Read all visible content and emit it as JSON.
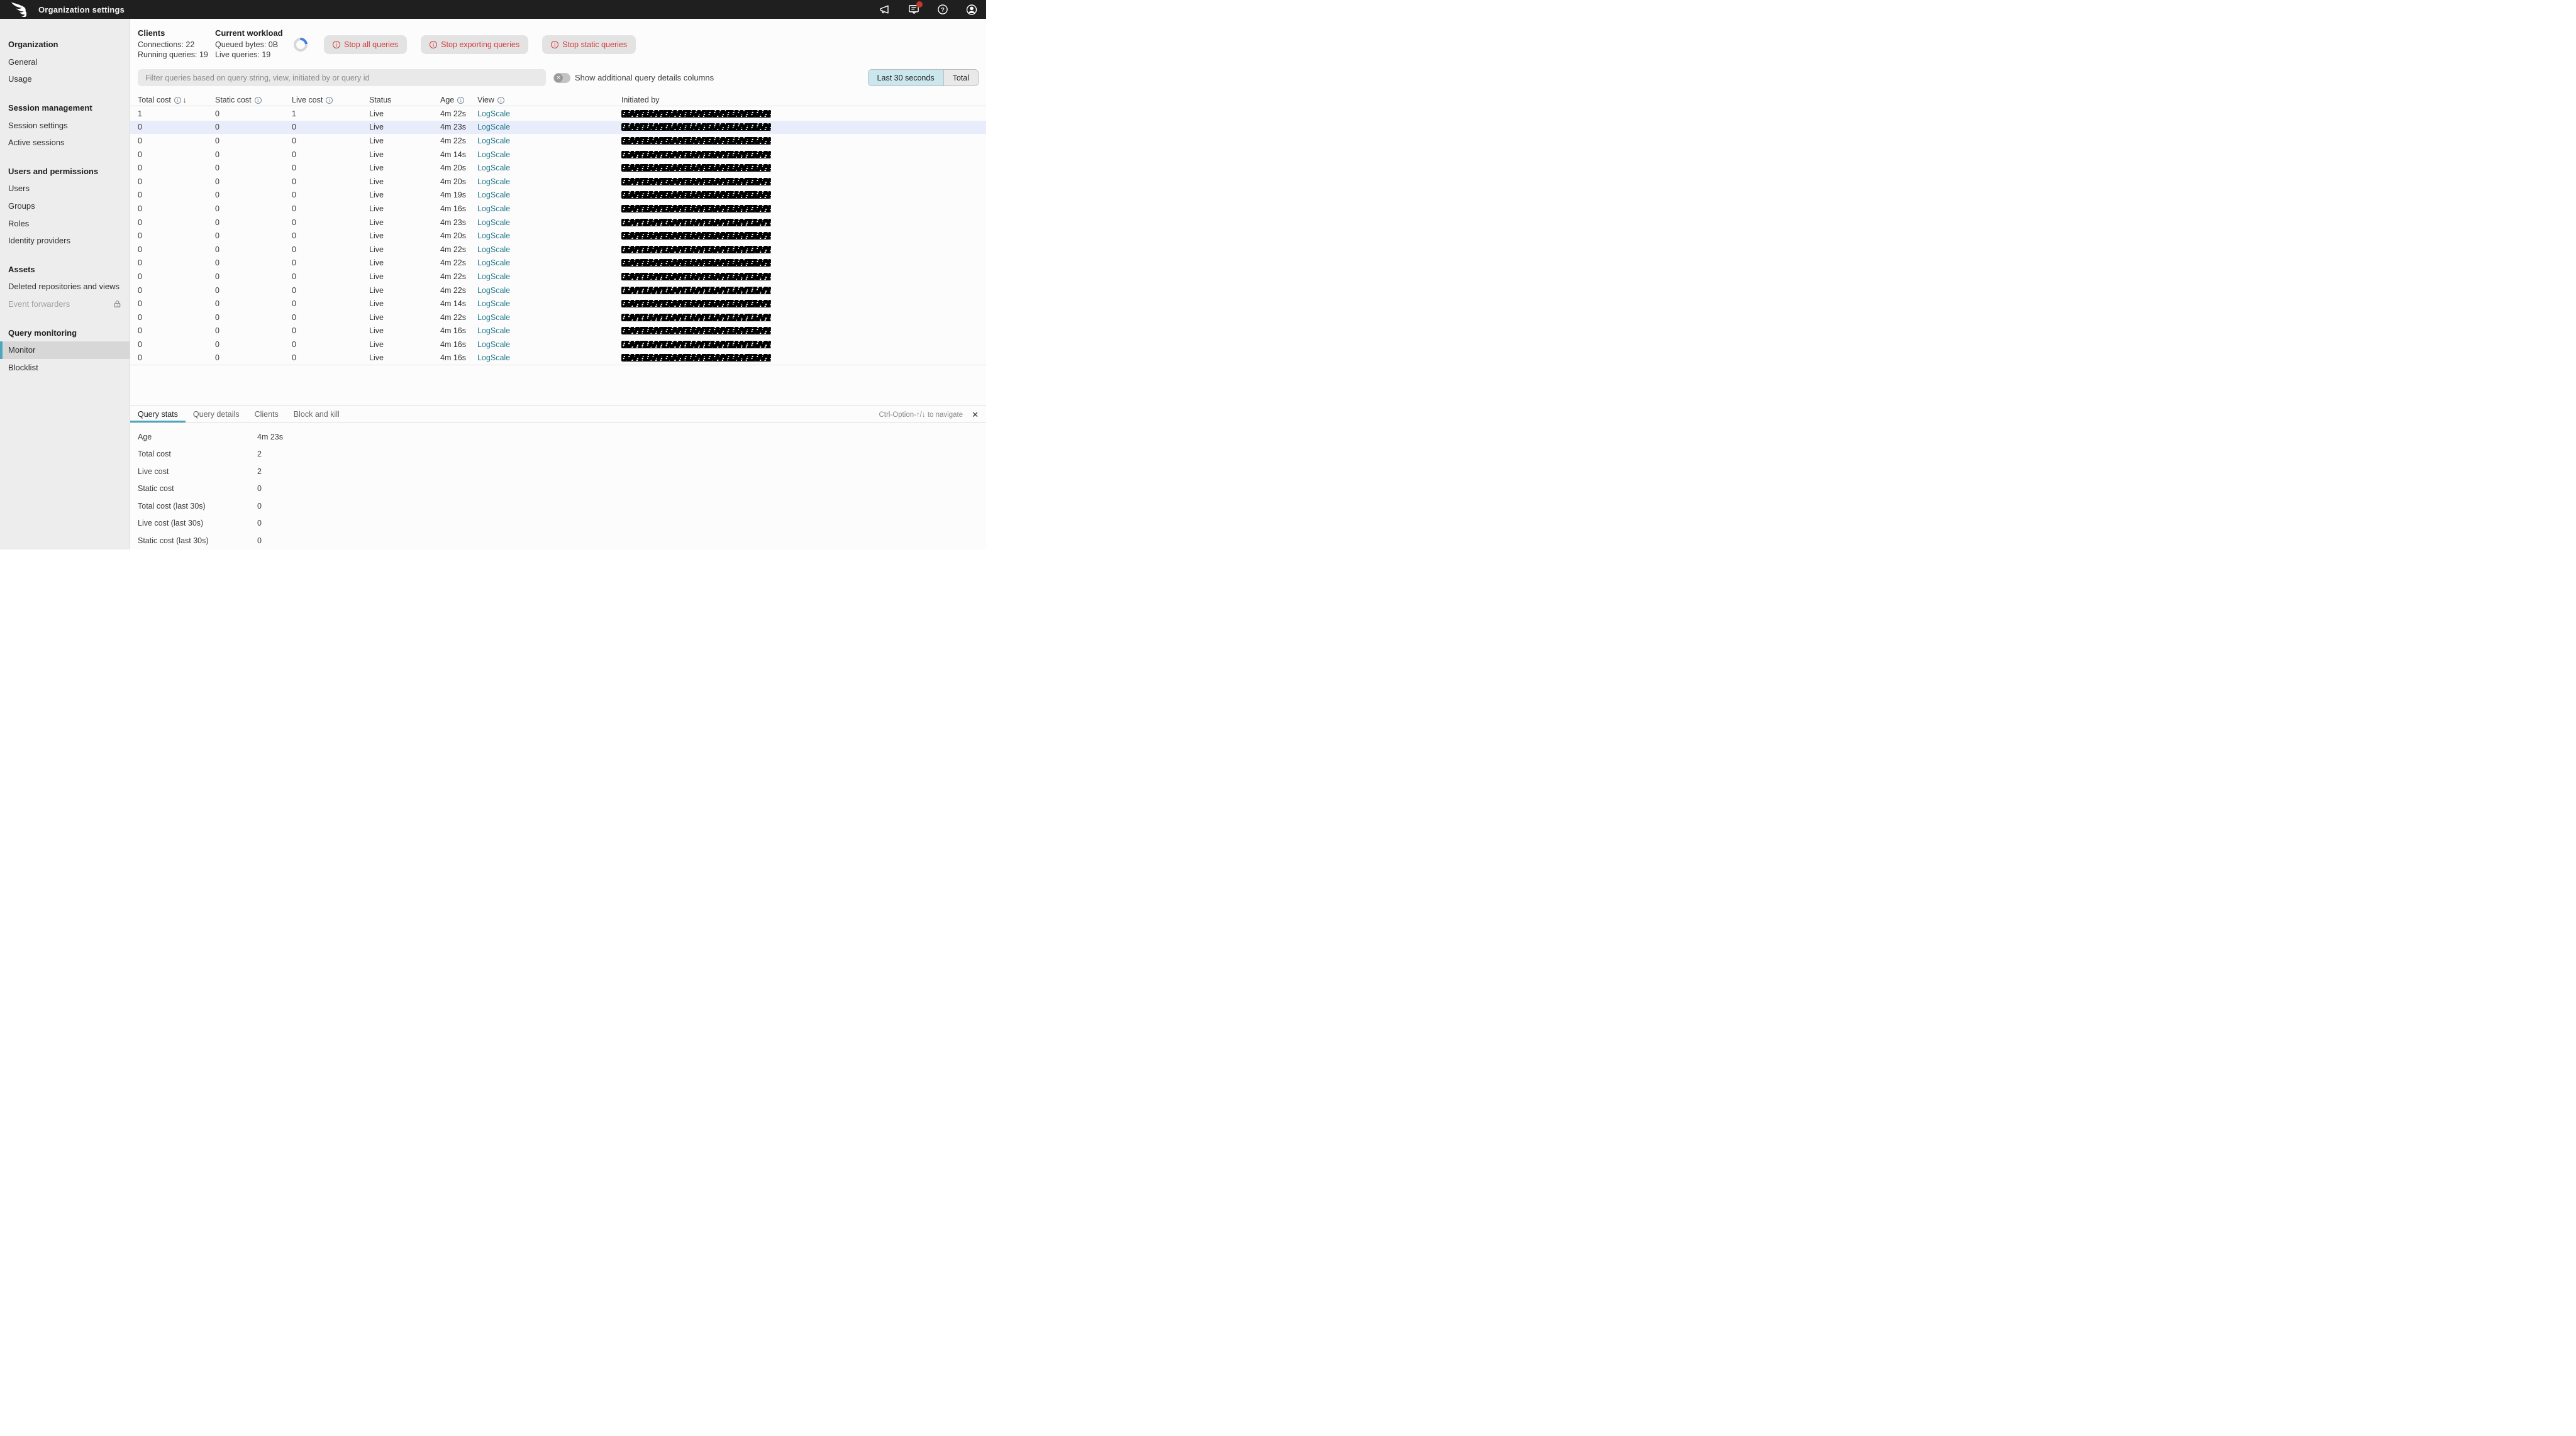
{
  "header": {
    "title": "Organization settings",
    "icons": [
      {
        "name": "announcements-icon"
      },
      {
        "name": "notifications-icon",
        "badge": true
      },
      {
        "name": "help-icon"
      },
      {
        "name": "account-icon"
      }
    ]
  },
  "sidebar": {
    "sections": [
      {
        "header": "Organization",
        "items": [
          {
            "label": "General"
          },
          {
            "label": "Usage"
          }
        ]
      },
      {
        "header": "Session management",
        "items": [
          {
            "label": "Session settings"
          },
          {
            "label": "Active sessions"
          }
        ]
      },
      {
        "header": "Users and permissions",
        "items": [
          {
            "label": "Users"
          },
          {
            "label": "Groups"
          },
          {
            "label": "Roles"
          },
          {
            "label": "Identity providers"
          }
        ]
      },
      {
        "header": "Assets",
        "items": [
          {
            "label": "Deleted repositories and views"
          },
          {
            "label": "Event forwarders",
            "disabled": true,
            "lock": true
          }
        ]
      },
      {
        "header": "Query monitoring",
        "items": [
          {
            "label": "Monitor",
            "selected": true
          },
          {
            "label": "Blocklist"
          }
        ]
      }
    ]
  },
  "stats": {
    "clients": {
      "title": "Clients",
      "lines": [
        "Connections: 22",
        "Running queries: 19"
      ]
    },
    "workload": {
      "title": "Current workload",
      "lines": [
        "Queued bytes: 0B",
        "Live queries: 19"
      ]
    }
  },
  "actions": {
    "stop_buttons": [
      "Stop all queries",
      "Stop exporting queries",
      "Stop static queries"
    ]
  },
  "filter": {
    "placeholder": "Filter queries based on query string, view, initiated by or query id",
    "toggle_label": "Show additional query details columns",
    "toggle_state": "off",
    "range_options": [
      "Last 30 seconds",
      "Total"
    ],
    "selected_range": "Last 30 seconds"
  },
  "table": {
    "columns": [
      {
        "label": "Total cost",
        "info": true,
        "sort": "desc"
      },
      {
        "label": "Static cost",
        "info": true
      },
      {
        "label": "Live cost",
        "info": true
      },
      {
        "label": "Status"
      },
      {
        "label": "Age",
        "info": true
      },
      {
        "label": "View",
        "info": true
      },
      {
        "label": "Initiated by"
      }
    ],
    "rows": [
      {
        "total": "1",
        "static": "0",
        "live": "1",
        "status": "Live",
        "age": "4m 22s",
        "view": "LogScale",
        "initiated_redacted": true,
        "selected": false
      },
      {
        "total": "0",
        "static": "0",
        "live": "0",
        "status": "Live",
        "age": "4m 23s",
        "view": "LogScale",
        "initiated_redacted": true,
        "selected": true
      },
      {
        "total": "0",
        "static": "0",
        "live": "0",
        "status": "Live",
        "age": "4m 22s",
        "view": "LogScale",
        "initiated_redacted": true,
        "selected": false
      },
      {
        "total": "0",
        "static": "0",
        "live": "0",
        "status": "Live",
        "age": "4m 14s",
        "view": "LogScale",
        "initiated_redacted": true,
        "selected": false
      },
      {
        "total": "0",
        "static": "0",
        "live": "0",
        "status": "Live",
        "age": "4m 20s",
        "view": "LogScale",
        "initiated_redacted": true,
        "selected": false
      },
      {
        "total": "0",
        "static": "0",
        "live": "0",
        "status": "Live",
        "age": "4m 20s",
        "view": "LogScale",
        "initiated_redacted": true,
        "selected": false
      },
      {
        "total": "0",
        "static": "0",
        "live": "0",
        "status": "Live",
        "age": "4m 19s",
        "view": "LogScale",
        "initiated_redacted": true,
        "selected": false
      },
      {
        "total": "0",
        "static": "0",
        "live": "0",
        "status": "Live",
        "age": "4m 16s",
        "view": "LogScale",
        "initiated_redacted": true,
        "selected": false
      },
      {
        "total": "0",
        "static": "0",
        "live": "0",
        "status": "Live",
        "age": "4m 23s",
        "view": "LogScale",
        "initiated_redacted": true,
        "selected": false
      },
      {
        "total": "0",
        "static": "0",
        "live": "0",
        "status": "Live",
        "age": "4m 20s",
        "view": "LogScale",
        "initiated_redacted": true,
        "selected": false
      },
      {
        "total": "0",
        "static": "0",
        "live": "0",
        "status": "Live",
        "age": "4m 22s",
        "view": "LogScale",
        "initiated_redacted": true,
        "selected": false
      },
      {
        "total": "0",
        "static": "0",
        "live": "0",
        "status": "Live",
        "age": "4m 22s",
        "view": "LogScale",
        "initiated_redacted": true,
        "selected": false
      },
      {
        "total": "0",
        "static": "0",
        "live": "0",
        "status": "Live",
        "age": "4m 22s",
        "view": "LogScale",
        "initiated_redacted": true,
        "selected": false
      },
      {
        "total": "0",
        "static": "0",
        "live": "0",
        "status": "Live",
        "age": "4m 22s",
        "view": "LogScale",
        "initiated_redacted": true,
        "selected": false
      },
      {
        "total": "0",
        "static": "0",
        "live": "0",
        "status": "Live",
        "age": "4m 14s",
        "view": "LogScale",
        "initiated_redacted": true,
        "selected": false
      },
      {
        "total": "0",
        "static": "0",
        "live": "0",
        "status": "Live",
        "age": "4m 22s",
        "view": "LogScale",
        "initiated_redacted": true,
        "selected": false
      },
      {
        "total": "0",
        "static": "0",
        "live": "0",
        "status": "Live",
        "age": "4m 16s",
        "view": "LogScale",
        "initiated_redacted": true,
        "selected": false
      },
      {
        "total": "0",
        "static": "0",
        "live": "0",
        "status": "Live",
        "age": "4m 16s",
        "view": "LogScale",
        "initiated_redacted": true,
        "selected": false
      },
      {
        "total": "0",
        "static": "0",
        "live": "0",
        "status": "Live",
        "age": "4m 16s",
        "view": "LogScale",
        "initiated_redacted": true,
        "selected": false
      }
    ]
  },
  "details": {
    "tabs": [
      {
        "label": "Query stats",
        "active": true
      },
      {
        "label": "Query details",
        "active": false
      },
      {
        "label": "Clients",
        "active": false
      },
      {
        "label": "Block and kill",
        "active": false
      }
    ],
    "shortcut_hint": "Ctrl-Option-↑/↓ to navigate",
    "close_label": "✕",
    "fields": [
      {
        "label": "Age",
        "value": "4m 23s"
      },
      {
        "label": "Total cost",
        "value": "2"
      },
      {
        "label": "Live cost",
        "value": "2"
      },
      {
        "label": "Static cost",
        "value": "0"
      },
      {
        "label": "Total cost (last 30s)",
        "value": "0"
      },
      {
        "label": "Live cost (last 30s)",
        "value": "0"
      },
      {
        "label": "Static cost (last 30s)",
        "value": "0"
      }
    ]
  },
  "colors": {
    "topbar_bg": "#1f1f1f",
    "accent_teal": "#4ba8bc",
    "link_teal": "#2a7d90",
    "danger_red": "#d43a3a",
    "badge_red": "#c0392b",
    "selected_row": "#e9edfb",
    "range_selected_bg": "#cbe7ee",
    "spinner_blue": "#4b79e4",
    "sidebar_bg": "#ededed",
    "sidebar_selected_bg": "#d7d7d7"
  }
}
